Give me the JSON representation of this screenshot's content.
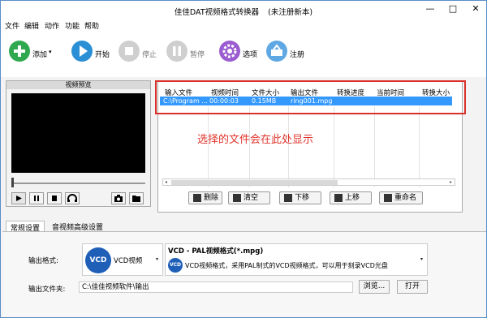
{
  "window": {
    "title": "佳佳DAT视频格式转换器",
    "subtitle": "(未注册新本)",
    "controls": {
      "min": "—",
      "max": "□",
      "close": "✕"
    }
  },
  "menu": [
    "文件",
    "编辑",
    "动作",
    "功能",
    "帮助"
  ],
  "toolbar": {
    "add": "添加",
    "add_dropdown": "▾",
    "start": "开始",
    "stop": "停止",
    "pause": "暂停",
    "options": "选项",
    "register": "注册"
  },
  "preview": {
    "header": "视频预览"
  },
  "file_table": {
    "columns": [
      "输入文件",
      "视频时间",
      "文件大小",
      "输出文件",
      "转换进度",
      "当前时间",
      "转换大小"
    ],
    "rows": [
      [
        "C:\\Program ...",
        "00:00:03",
        "0.15MB",
        "ring001.mpg",
        "",
        "",
        ""
      ]
    ],
    "hint": "选择的文件会在此处显示",
    "scroll_left": "◂",
    "scroll_right": "▸"
  },
  "actions": {
    "delete": "删除",
    "clear": "清空",
    "down": "下移",
    "up": "上移",
    "rename": "重命名"
  },
  "tabs": [
    "常规设置",
    "音视频高级设置"
  ],
  "settings": {
    "output_format_label": "输出格式:",
    "format_icon_text": "VCD",
    "format_name": "VCD视频",
    "format_title": "VCD - PAL视频格式(*.mpg)",
    "format_desc": "VCD视频格式，采用PAL制式的VCD视频格式，可以用于刻录VCD光盘",
    "dropdown_arrow": "▾",
    "output_folder_label": "输出文件夹:",
    "output_folder_value": "C:\\佳佳视频软件\\输出",
    "browse": "浏览...",
    "open": "打开"
  },
  "colors": {
    "selection": "#3399ff",
    "hint_red": "#e0352c",
    "add_green": "#2fa84f",
    "start_blue": "#2b8fd6",
    "options_purple": "#9b5cd1",
    "register_blue": "#5fa8e3",
    "vcd_blue": "#1f5fb8"
  }
}
